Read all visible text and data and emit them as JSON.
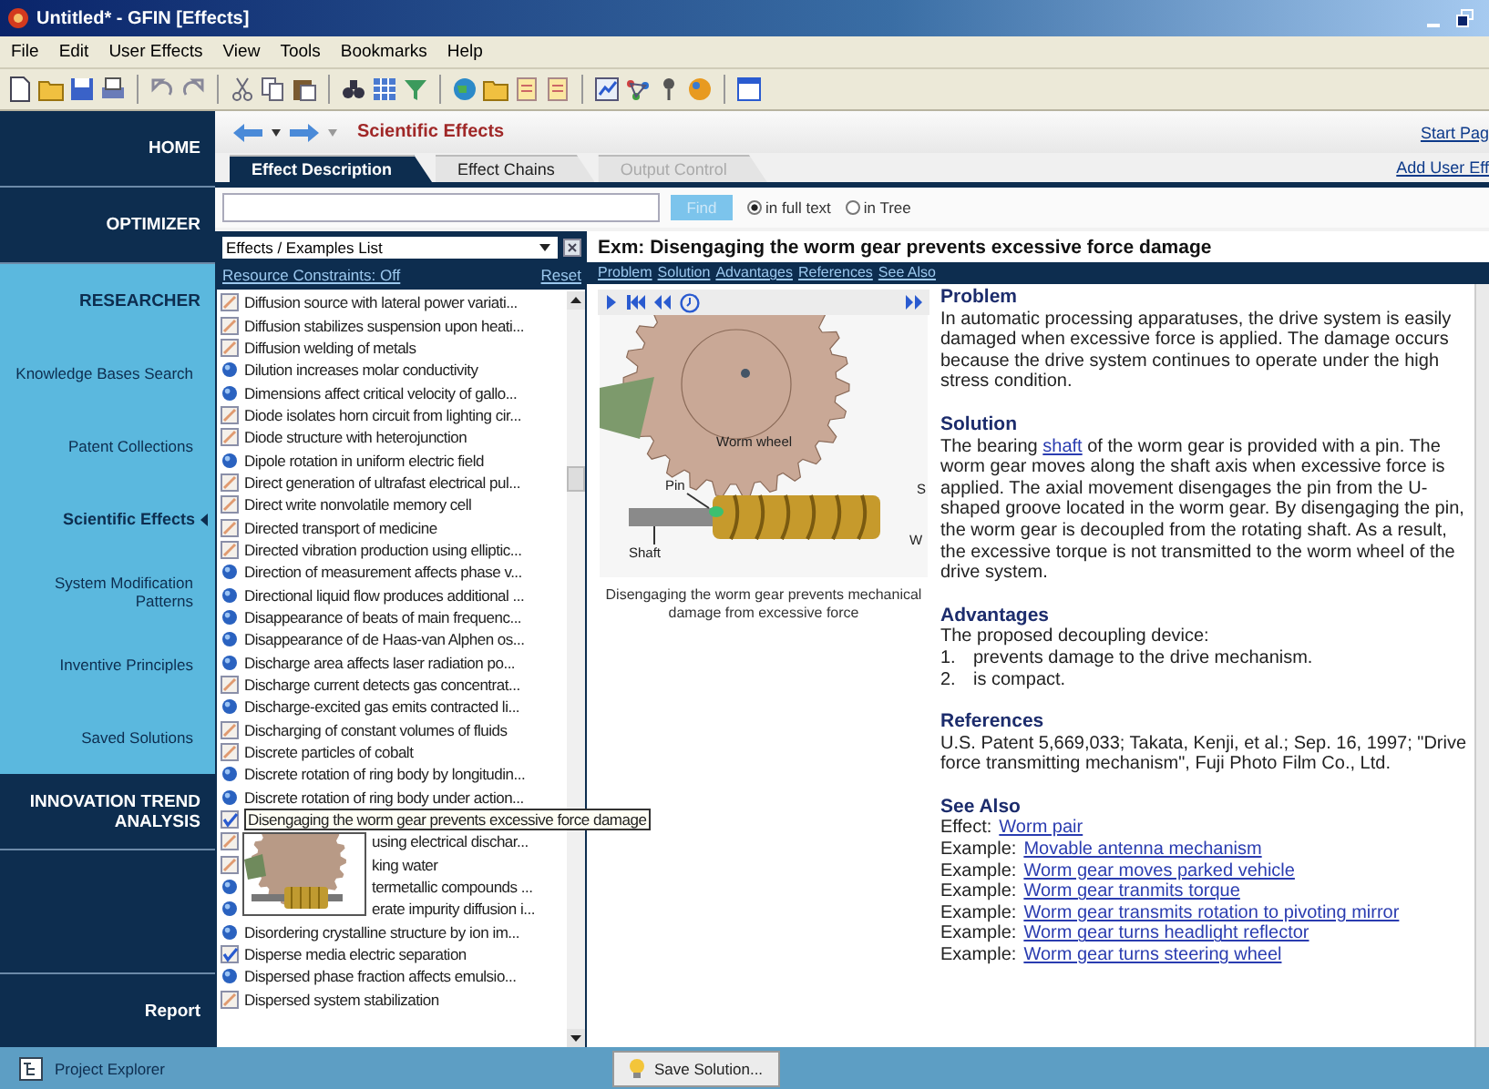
{
  "window": {
    "title": "Untitled* - GFIN [Effects]"
  },
  "menu": [
    "File",
    "Edit",
    "User Effects",
    "View",
    "Tools",
    "Bookmarks",
    "Help"
  ],
  "sidebar": {
    "items": [
      {
        "kind": "section",
        "label": "HOME",
        "expanded": false,
        "selected": false
      },
      {
        "kind": "section",
        "label": "OPTIMIZER",
        "expanded": false,
        "selected": false
      },
      {
        "kind": "section",
        "label": "RESEARCHER",
        "expanded": true,
        "selected": false
      },
      {
        "kind": "item",
        "label": "Knowledge Bases Search",
        "selected": false
      },
      {
        "kind": "item",
        "label": "Patent Collections",
        "selected": false
      },
      {
        "kind": "item",
        "label": "Scientific Effects",
        "selected": true
      },
      {
        "kind": "item",
        "label": "System Modification Patterns",
        "selected": false
      },
      {
        "kind": "item",
        "label": "Inventive Principles",
        "selected": false
      },
      {
        "kind": "item",
        "label": "Saved Solutions",
        "selected": false
      },
      {
        "kind": "section",
        "label": "INNOVATION TREND ANALYSIS",
        "expanded": false,
        "selected": false
      }
    ],
    "footer": "Report"
  },
  "nav": {
    "path": "Scientific Effects",
    "start_link": "Start Pag",
    "add_link": "Add User Eff"
  },
  "tabs": [
    {
      "label": "Effect Description",
      "selected": true,
      "disabled": false
    },
    {
      "label": "Effect Chains",
      "selected": false,
      "disabled": false
    },
    {
      "label": "Output Control",
      "selected": false,
      "disabled": true
    }
  ],
  "search": {
    "button": "Find",
    "options": [
      {
        "label": "in full text",
        "selected": true
      },
      {
        "label": "in Tree",
        "selected": false
      }
    ]
  },
  "list": {
    "dropdown": "Effects / Examples List",
    "constraints": "Resource Constraints: Off",
    "reset": "Reset",
    "items": [
      {
        "kind": "doc",
        "text": "Diffusion source with lateral power variati...",
        "hovered": false
      },
      {
        "kind": "doc",
        "text": "Diffusion stabilizes suspension upon heati...",
        "hovered": false
      },
      {
        "kind": "doc",
        "text": "Diffusion welding of metals",
        "hovered": false
      },
      {
        "kind": "dot",
        "text": "Dilution increases molar conductivity",
        "hovered": false
      },
      {
        "kind": "dot",
        "text": "Dimensions affect critical velocity of gallo...",
        "hovered": false
      },
      {
        "kind": "doc",
        "text": "Diode isolates horn circuit from lighting cir...",
        "hovered": false
      },
      {
        "kind": "doc",
        "text": "Diode structure with heterojunction",
        "hovered": false
      },
      {
        "kind": "dot",
        "text": "Dipole rotation in uniform electric field",
        "hovered": false
      },
      {
        "kind": "doc",
        "text": "Direct generation of ultrafast electrical pul...",
        "hovered": false
      },
      {
        "kind": "doc",
        "text": "Direct write nonvolatile memory cell",
        "hovered": false
      },
      {
        "kind": "doc",
        "text": "Directed transport of medicine",
        "hovered": false
      },
      {
        "kind": "doc",
        "text": "Directed vibration production using elliptic...",
        "hovered": false
      },
      {
        "kind": "dot",
        "text": "Direction of measurement affects phase v...",
        "hovered": false
      },
      {
        "kind": "dot",
        "text": "Directional liquid flow produces additional ...",
        "hovered": false
      },
      {
        "kind": "dot",
        "text": "Disappearance of beats of main frequenc...",
        "hovered": false
      },
      {
        "kind": "dot",
        "text": "Disappearance of de Haas-van Alphen os...",
        "hovered": false
      },
      {
        "kind": "dot",
        "text": "Discharge area affects laser radiation po...",
        "hovered": false
      },
      {
        "kind": "doc",
        "text": "Discharge current detects gas concentrat...",
        "hovered": false
      },
      {
        "kind": "dot",
        "text": "Discharge-excited gas emits contracted li...",
        "hovered": false
      },
      {
        "kind": "doc",
        "text": "Discharging of constant volumes of fluids",
        "hovered": false
      },
      {
        "kind": "doc",
        "text": "Discrete particles of cobalt",
        "hovered": false
      },
      {
        "kind": "dot",
        "text": "Discrete rotation of ring body by longitudin...",
        "hovered": false
      },
      {
        "kind": "dot",
        "text": "Discrete rotation of ring body under action...",
        "hovered": false
      },
      {
        "kind": "check",
        "text": "Disengaging the worm gear prevents excessive force damage",
        "hovered": true,
        "preview_rows": [
          {
            "kind": "doc",
            "text": "using electrical dischar..."
          },
          {
            "kind": "doc",
            "text": "king water"
          },
          {
            "kind": "dot",
            "text": "termetallic compounds ..."
          },
          {
            "kind": "dot",
            "text": "erate impurity diffusion i..."
          }
        ]
      },
      {
        "kind": "dot",
        "text": "Disordering crystalline structure by ion im...",
        "hovered": false
      },
      {
        "kind": "check",
        "text": "Disperse media electric separation",
        "hovered": false
      },
      {
        "kind": "dot",
        "text": "Dispersed phase fraction affects emulsio...",
        "hovered": false
      },
      {
        "kind": "doc",
        "text": "Dispersed system stabilization",
        "hovered": false
      }
    ]
  },
  "detail": {
    "title": "Exm: Disengaging the worm gear prevents excessive force damage",
    "links": [
      "Problem",
      "Solution",
      "Advantages",
      "References",
      "See Also"
    ],
    "media": {
      "labels": [
        "Worm wheel",
        "Pin",
        "Shaft",
        "S",
        "W"
      ],
      "caption": "Disengaging the worm gear prevents mechanical damage from excessive force"
    },
    "problem": {
      "heading": "Problem",
      "text": "In automatic processing apparatuses, the drive system is easily damaged when excessive force is applied.  The damage occurs because the drive system continues to operate under the high stress condition."
    },
    "solution": {
      "heading": "Solution",
      "before": "The bearing ",
      "link": "shaft",
      "after": " of the worm gear is provided with a pin.  The worm gear moves along the shaft axis when excessive force is applied.  The axial movement disengages the pin from the U-shaped groove located in the worm gear.  By disengaging the pin, the worm gear is decoupled from the rotating shaft.  As a result, the excessive torque is not transmitted to the worm wheel of the drive system."
    },
    "advantages": {
      "heading": "Advantages",
      "intro": "The proposed decoupling device:",
      "items": [
        {
          "num": "1.",
          "text": "prevents damage to the drive mechanism."
        },
        {
          "num": "2.",
          "text": "is compact."
        }
      ]
    },
    "references": {
      "heading": "References",
      "text": "U.S. Patent  5,669,033; Takata, Kenji, et al.; Sep. 16, 1997; \"Drive force transmitting mechanism\", Fuji Photo Film Co., Ltd."
    },
    "see_also": {
      "heading": "See Also",
      "items": [
        {
          "label": "Effect:",
          "link": "Worm pair"
        },
        {
          "label": "Example:",
          "link": "Movable antenna mechanism"
        },
        {
          "label": "Example:",
          "link": "Worm gear moves parked vehicle"
        },
        {
          "label": "Example:",
          "link": "Worm gear tranmits torque"
        },
        {
          "label": "Example:",
          "link": "Worm gear transmits rotation to pivoting mirror"
        },
        {
          "label": "Example:",
          "link": "Worm gear turns headlight reflector"
        },
        {
          "label": "Example:",
          "link": "Worm gear turns steering wheel"
        }
      ]
    }
  },
  "bottom": {
    "explorer": "Project Explorer",
    "save": "Save Solution..."
  }
}
